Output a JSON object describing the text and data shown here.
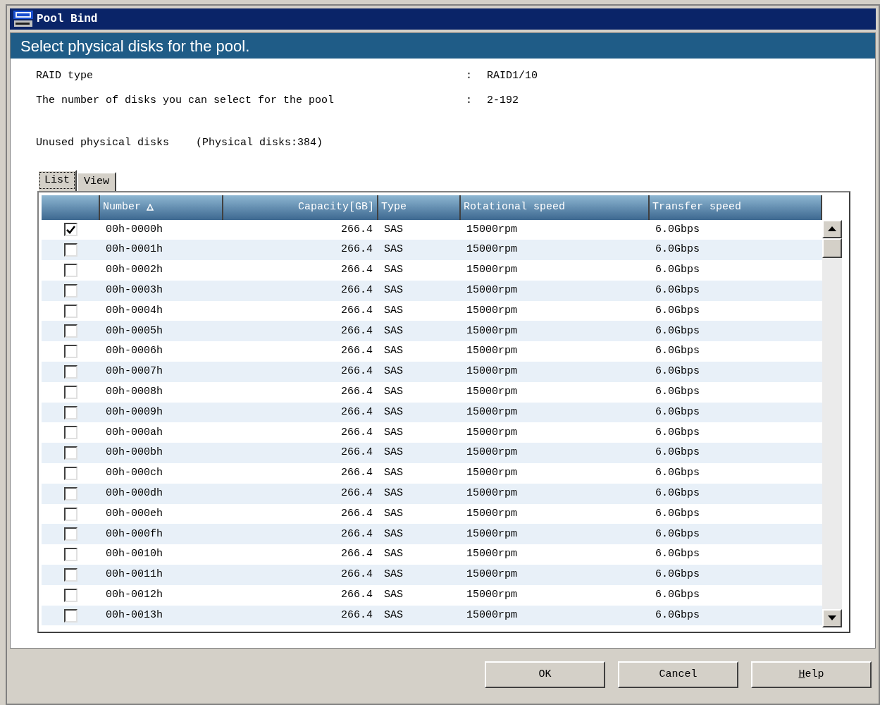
{
  "window": {
    "title": "Pool Bind"
  },
  "banner": "Select physical disks for the pool.",
  "info": [
    {
      "label": "RAID type",
      "separator": ":",
      "value": "RAID1/10"
    },
    {
      "label": "The number of disks you can select for the pool",
      "separator": ":",
      "value": "2-192"
    }
  ],
  "disks_heading": {
    "label": "Unused physical disks",
    "count": "(Physical disks:384)"
  },
  "tabs": [
    {
      "label": "List",
      "selected": true
    },
    {
      "label": "View",
      "selected": false
    }
  ],
  "table": {
    "columns": [
      {
        "label": "Number",
        "sorted": true
      },
      {
        "label": "Capacity[GB]",
        "sorted": false
      },
      {
        "label": "Type",
        "sorted": false
      },
      {
        "label": "Rotational speed",
        "sorted": false
      },
      {
        "label": "Transfer speed",
        "sorted": false
      }
    ],
    "rows": [
      {
        "checked": true,
        "cells": [
          "00h-0000h",
          "266.4",
          "SAS",
          "15000rpm",
          "6.0Gbps"
        ]
      },
      {
        "checked": false,
        "cells": [
          "00h-0001h",
          "266.4",
          "SAS",
          "15000rpm",
          "6.0Gbps"
        ]
      },
      {
        "checked": false,
        "cells": [
          "00h-0002h",
          "266.4",
          "SAS",
          "15000rpm",
          "6.0Gbps"
        ]
      },
      {
        "checked": false,
        "cells": [
          "00h-0003h",
          "266.4",
          "SAS",
          "15000rpm",
          "6.0Gbps"
        ]
      },
      {
        "checked": false,
        "cells": [
          "00h-0004h",
          "266.4",
          "SAS",
          "15000rpm",
          "6.0Gbps"
        ]
      },
      {
        "checked": false,
        "cells": [
          "00h-0005h",
          "266.4",
          "SAS",
          "15000rpm",
          "6.0Gbps"
        ]
      },
      {
        "checked": false,
        "cells": [
          "00h-0006h",
          "266.4",
          "SAS",
          "15000rpm",
          "6.0Gbps"
        ]
      },
      {
        "checked": false,
        "cells": [
          "00h-0007h",
          "266.4",
          "SAS",
          "15000rpm",
          "6.0Gbps"
        ]
      },
      {
        "checked": false,
        "cells": [
          "00h-0008h",
          "266.4",
          "SAS",
          "15000rpm",
          "6.0Gbps"
        ]
      },
      {
        "checked": false,
        "cells": [
          "00h-0009h",
          "266.4",
          "SAS",
          "15000rpm",
          "6.0Gbps"
        ]
      },
      {
        "checked": false,
        "cells": [
          "00h-000ah",
          "266.4",
          "SAS",
          "15000rpm",
          "6.0Gbps"
        ]
      },
      {
        "checked": false,
        "cells": [
          "00h-000bh",
          "266.4",
          "SAS",
          "15000rpm",
          "6.0Gbps"
        ]
      },
      {
        "checked": false,
        "cells": [
          "00h-000ch",
          "266.4",
          "SAS",
          "15000rpm",
          "6.0Gbps"
        ]
      },
      {
        "checked": false,
        "cells": [
          "00h-000dh",
          "266.4",
          "SAS",
          "15000rpm",
          "6.0Gbps"
        ]
      },
      {
        "checked": false,
        "cells": [
          "00h-000eh",
          "266.4",
          "SAS",
          "15000rpm",
          "6.0Gbps"
        ]
      },
      {
        "checked": false,
        "cells": [
          "00h-000fh",
          "266.4",
          "SAS",
          "15000rpm",
          "6.0Gbps"
        ]
      },
      {
        "checked": false,
        "cells": [
          "00h-0010h",
          "266.4",
          "SAS",
          "15000rpm",
          "6.0Gbps"
        ]
      },
      {
        "checked": false,
        "cells": [
          "00h-0011h",
          "266.4",
          "SAS",
          "15000rpm",
          "6.0Gbps"
        ]
      },
      {
        "checked": false,
        "cells": [
          "00h-0012h",
          "266.4",
          "SAS",
          "15000rpm",
          "6.0Gbps"
        ]
      },
      {
        "checked": false,
        "cells": [
          "00h-0013h",
          "266.4",
          "SAS",
          "15000rpm",
          "6.0Gbps"
        ]
      }
    ]
  },
  "buttons": [
    {
      "label": "OK",
      "mnemonic": false
    },
    {
      "label": "Cancel",
      "mnemonic": false
    },
    {
      "label": "Help",
      "mnemonic": true
    }
  ]
}
